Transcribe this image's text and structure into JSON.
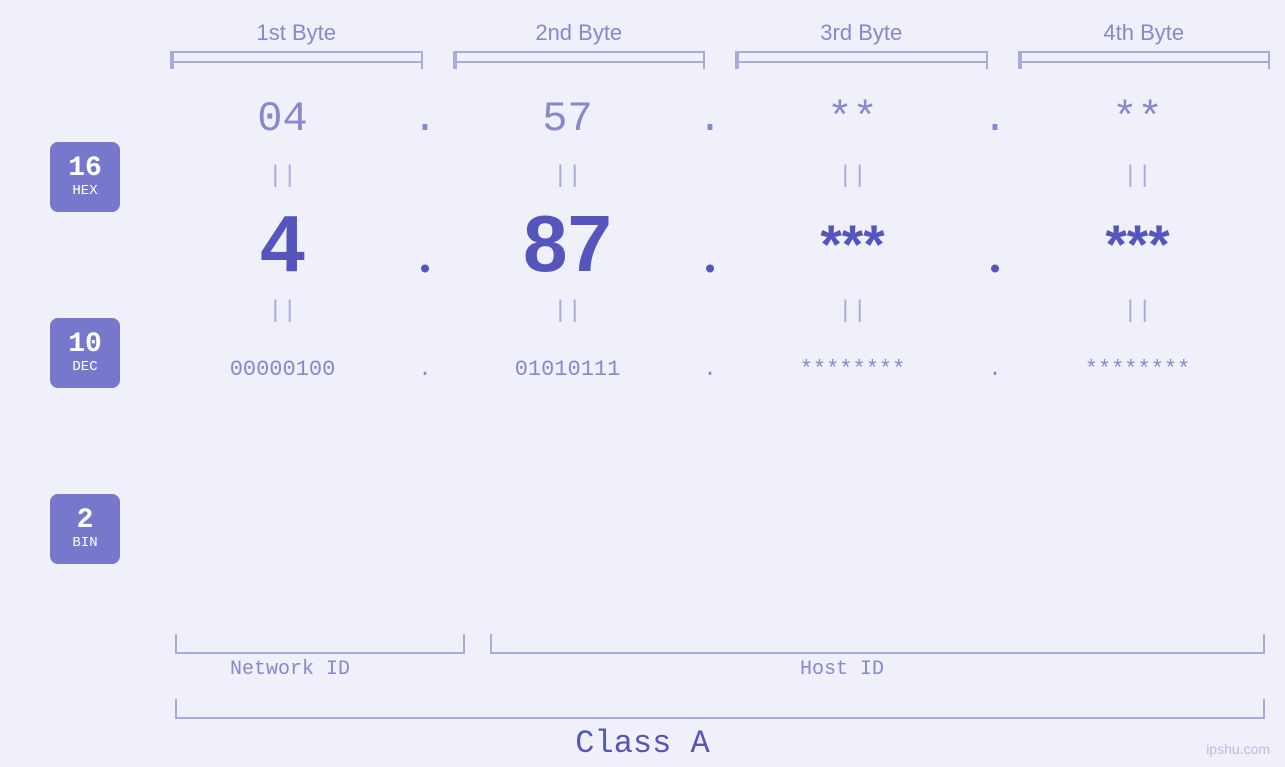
{
  "headers": {
    "byte1": "1st Byte",
    "byte2": "2nd Byte",
    "byte3": "3rd Byte",
    "byte4": "4th Byte"
  },
  "badges": {
    "hex": {
      "number": "16",
      "label": "HEX"
    },
    "dec": {
      "number": "10",
      "label": "DEC"
    },
    "bin": {
      "number": "2",
      "label": "BIN"
    }
  },
  "hex_row": {
    "b1": "04",
    "b2": "57",
    "b3": "**",
    "b4": "**",
    "dots": [
      ".",
      ".",
      "."
    ]
  },
  "dec_row": {
    "b1": "4",
    "b2": "87",
    "b3": "***",
    "b4": "***",
    "dots": [
      ".",
      ".",
      "."
    ]
  },
  "bin_row": {
    "b1": "00000100",
    "b2": "01010111",
    "b3": "********",
    "b4": "********",
    "dots": [
      ".",
      ".",
      "."
    ]
  },
  "equals": {
    "symbol": "||"
  },
  "labels": {
    "network_id": "Network ID",
    "host_id": "Host ID",
    "class": "Class A"
  },
  "watermark": "ipshu.com"
}
